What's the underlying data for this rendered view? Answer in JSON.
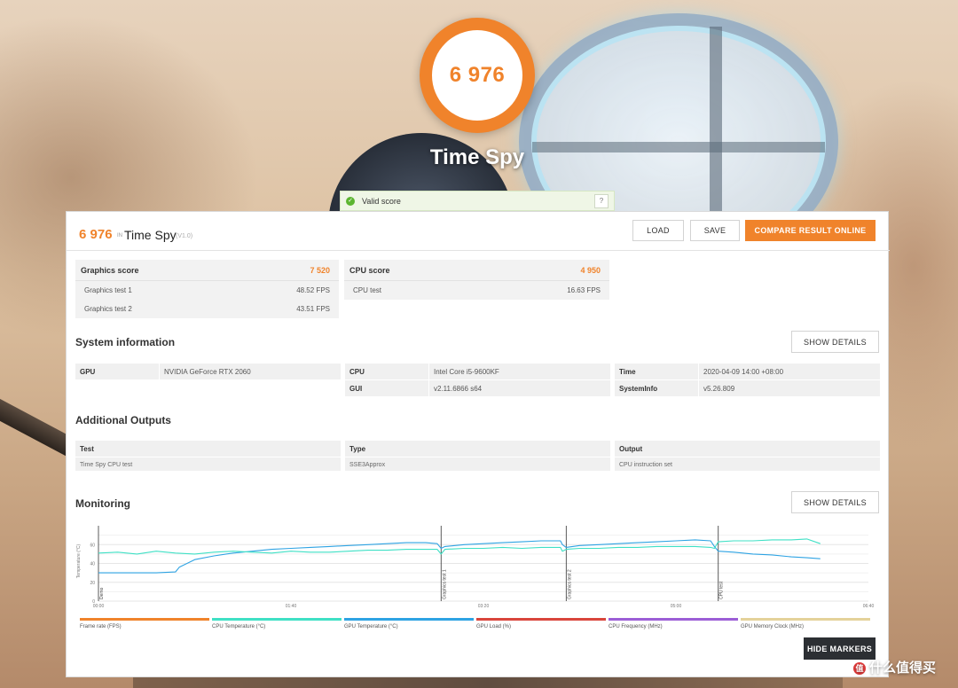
{
  "hero": {
    "score": "6 976",
    "test_name": "Time Spy",
    "valid_label": "Valid score",
    "help_glyph": "?"
  },
  "header": {
    "score": "6 976",
    "in_label": "IN",
    "test_name": "Time Spy",
    "version": "(V1.0)",
    "load_label": "LOAD",
    "save_label": "SAVE",
    "compare_label": "COMPARE RESULT ONLINE"
  },
  "graphics": {
    "title": "Graphics score",
    "score": "7 520",
    "rows": [
      {
        "label": "Graphics test 1",
        "value": "48.52 FPS"
      },
      {
        "label": "Graphics test 2",
        "value": "43.51 FPS"
      }
    ]
  },
  "cpu": {
    "title": "CPU score",
    "score": "4 950",
    "rows": [
      {
        "label": "CPU test",
        "value": "16.63 FPS"
      }
    ]
  },
  "system_info": {
    "title": "System information",
    "details_label": "SHOW DETAILS",
    "cells": [
      {
        "key": "GPU",
        "value": "NVIDIA GeForce RTX 2060"
      },
      {
        "key": "CPU",
        "value": "Intel Core i5-9600KF"
      },
      {
        "key": "Time",
        "value": "2020-04-09 14:00 +08:00"
      },
      {
        "key": "GUI",
        "value": "v2.11.6866 s64"
      },
      {
        "key": "SystemInfo",
        "value": "v5.26.809"
      }
    ]
  },
  "additional": {
    "title": "Additional Outputs",
    "headers": [
      "Test",
      "Type",
      "Output"
    ],
    "values": [
      "Time Spy CPU test",
      "SSE3Approx",
      "CPU instruction set"
    ]
  },
  "monitoring": {
    "title": "Monitoring",
    "details_label": "SHOW DETAILS",
    "hide_markers_label": "HIDE MARKERS",
    "y_axis_label": "Temperature (°C)",
    "y_ticks": [
      "60",
      "40",
      "20",
      "0"
    ],
    "x_ticks": [
      "00:00",
      "01:40",
      "03:20",
      "05:00",
      "06:40"
    ],
    "markers": [
      "Demo",
      "Graphics test 1",
      "Graphics test 2",
      "CPU test"
    ],
    "legend": [
      {
        "label": "Frame rate (FPS)",
        "color": "#f0832b"
      },
      {
        "label": "CPU Temperature (°C)",
        "color": "#3fe0c5"
      },
      {
        "label": "GPU Temperature (°C)",
        "color": "#2ea3e3"
      },
      {
        "label": "GPU Load (%)",
        "color": "#d9453b"
      },
      {
        "label": "CPU Frequency (MHz)",
        "color": "#9c5ed6"
      },
      {
        "label": "GPU Memory Clock (MHz)",
        "color": "#e4d29a"
      }
    ]
  },
  "chart_data": {
    "type": "line",
    "ylabel": "Temperature (°C)",
    "ylim": [
      0,
      80
    ],
    "xlim": [
      0,
      400
    ],
    "x_tick_labels": [
      "00:00",
      "01:40",
      "03:20",
      "05:00",
      "06:40"
    ],
    "markers": [
      {
        "label": "Demo",
        "x": 0
      },
      {
        "label": "Graphics test 1",
        "x": 178
      },
      {
        "label": "Graphics test 2",
        "x": 243
      },
      {
        "label": "CPU test",
        "x": 322
      }
    ],
    "series": [
      {
        "name": "GPU Temperature (°C)",
        "color": "#2ea3e3",
        "x": [
          0,
          10,
          20,
          30,
          40,
          42,
          50,
          60,
          70,
          80,
          90,
          100,
          110,
          120,
          130,
          140,
          150,
          160,
          170,
          176,
          178,
          180,
          190,
          200,
          210,
          220,
          230,
          240,
          241,
          243,
          250,
          260,
          270,
          280,
          290,
          300,
          310,
          318,
          320,
          322,
          330,
          340,
          350,
          360,
          368,
          375
        ],
        "y": [
          30,
          30,
          30,
          30,
          31,
          36,
          44,
          48,
          51,
          53,
          55,
          56,
          57,
          58,
          59,
          60,
          61,
          62,
          62,
          61,
          56,
          58,
          60,
          61,
          62,
          63,
          64,
          64,
          60,
          57,
          59,
          60,
          61,
          62,
          63,
          64,
          65,
          64,
          58,
          53,
          52,
          50,
          49,
          47,
          46,
          45
        ]
      },
      {
        "name": "CPU Temperature (°C)",
        "color": "#3fe0c5",
        "x": [
          0,
          10,
          20,
          30,
          40,
          50,
          60,
          70,
          80,
          90,
          100,
          110,
          120,
          130,
          140,
          150,
          160,
          170,
          176,
          178,
          180,
          190,
          200,
          210,
          220,
          230,
          240,
          241,
          243,
          250,
          260,
          270,
          280,
          290,
          300,
          310,
          318,
          320,
          322,
          330,
          340,
          350,
          360,
          368,
          375
        ],
        "y": [
          51,
          52,
          50,
          53,
          51,
          50,
          52,
          53,
          52,
          51,
          53,
          52,
          52,
          53,
          54,
          54,
          55,
          55,
          55,
          50,
          55,
          56,
          56,
          57,
          56,
          57,
          57,
          53,
          55,
          56,
          56,
          57,
          57,
          58,
          58,
          58,
          57,
          56,
          63,
          64,
          64,
          65,
          65,
          66,
          61
        ]
      }
    ]
  },
  "watermark": {
    "icon_glyph": "值",
    "text": "什么值得买"
  }
}
